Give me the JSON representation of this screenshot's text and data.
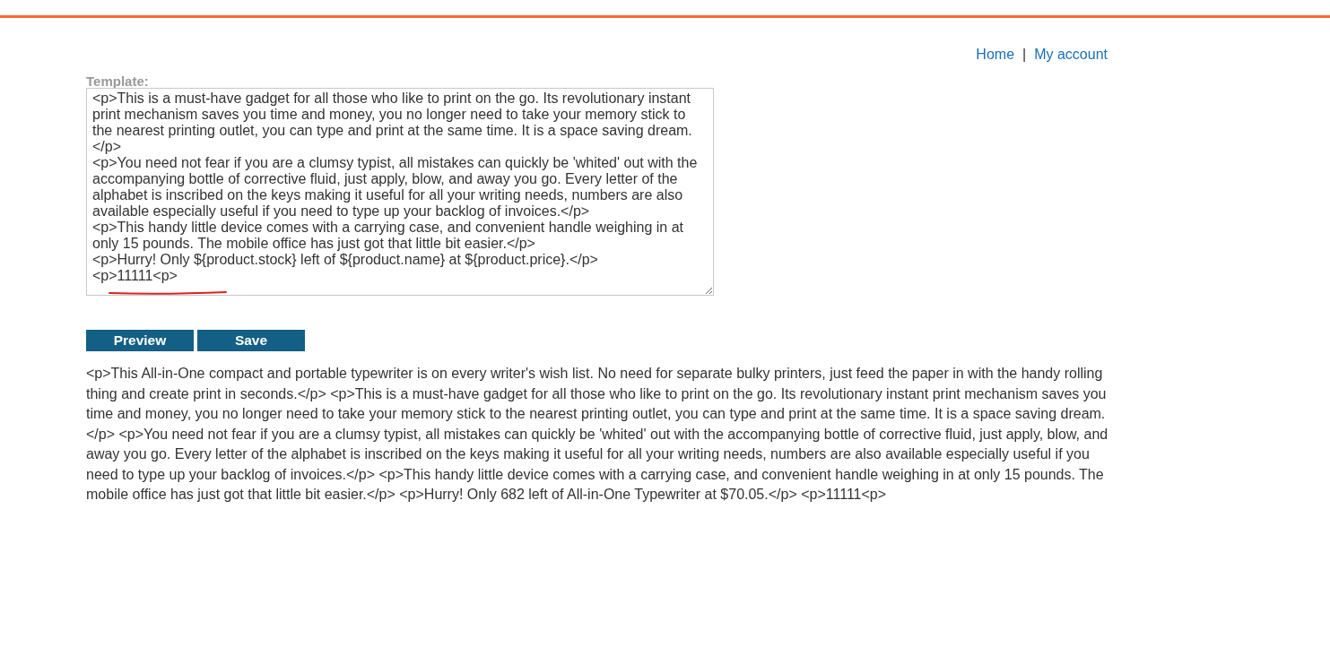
{
  "nav": [
    {
      "label": "Home"
    },
    {
      "label": "My account"
    }
  ],
  "nav_separator": "|",
  "template": {
    "label": "Template:",
    "value": "<p>This is a must-have gadget for all those who like to print on the go. Its revolutionary instant print mechanism saves you time and money, you no longer need to take your memory stick to the nearest printing outlet, you can type and print at the same time. It is a space saving dream. </p>\n<p>You need not fear if you are a clumsy typist, all mistakes can quickly be 'whited' out with the accompanying bottle of corrective fluid, just apply, blow, and away you go. Every letter of the alphabet is inscribed on the keys making it useful for all your writing needs, numbers are also available especially useful if you need to type up your backlog of invoices.</p>\n<p>This handy little device comes with a carrying case, and convenient handle weighing in at only 15 pounds. The mobile office has just got that little bit easier.</p>\n<p>Hurry! Only ${product.stock} left of ${product.name} at ${product.price}.</p>\n<p>11111<p>"
  },
  "buttons": [
    {
      "label": "Preview"
    },
    {
      "label": "Save"
    }
  ],
  "preview": "<p>This All-in-One compact and portable typewriter is on every writer's wish list. No need for separate bulky printers, just feed the paper in with the handy rolling thing and create print in seconds.</p> <p>This is a must-have gadget for all those who like to print on the go. Its revolutionary instant print mechanism saves you time and money, you no longer need to take your memory stick to the nearest printing outlet, you can type and print at the same time. It is a space saving dream. </p> <p>You need not fear if you are a clumsy typist, all mistakes can quickly be 'whited' out with the accompanying bottle of corrective fluid, just apply, blow, and away you go. Every letter of the alphabet is inscribed on the keys making it useful for all your writing needs, numbers are also available especially useful if you need to type up your backlog of invoices.</p> <p>This handy little device comes with a carrying case, and convenient handle weighing in at only 15 pounds. The mobile office has just got that little bit easier.</p> <p>Hurry! Only 682 left of All-in-One Typewriter at $70.05.</p> <p>11111<p>"
}
